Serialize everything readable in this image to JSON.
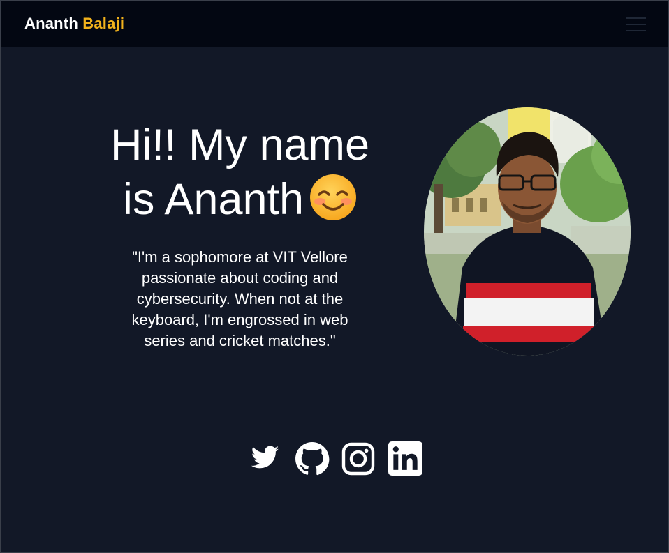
{
  "navbar": {
    "brand_first": "Ananth",
    "brand_last": "Balaji",
    "menu_icon": "hamburger-menu-icon"
  },
  "hero": {
    "headline_line1": "Hi!! My name",
    "headline_line2": "is Ananth",
    "emoji_icon": "smiling-face-emoji",
    "bio": "\"I'm a sophomore at VIT Vellore passionate about coding and cybersecurity. When not at the keyboard, I'm engrossed in web series and cricket matches.\""
  },
  "profile_photo": {
    "alt": "Ananth Balaji"
  },
  "socials": [
    {
      "name": "twitter",
      "icon": "twitter-icon"
    },
    {
      "name": "github",
      "icon": "github-icon"
    },
    {
      "name": "instagram",
      "icon": "instagram-icon"
    },
    {
      "name": "linkedin",
      "icon": "linkedin-icon"
    }
  ],
  "colors": {
    "background": "#121827",
    "navbar": "#030712",
    "accent": "#f2b21c",
    "text": "#ffffff"
  }
}
